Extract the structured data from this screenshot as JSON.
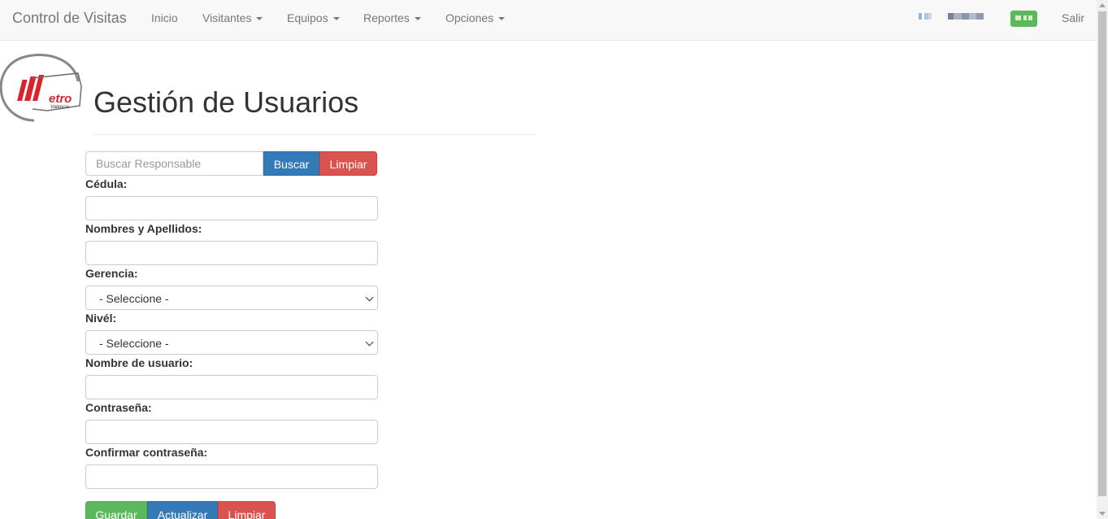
{
  "navbar": {
    "brand": "Control de Visitas",
    "items": [
      {
        "label": "Inicio"
      },
      {
        "label": "Visitantes"
      },
      {
        "label": "Equipos"
      },
      {
        "label": "Reportes"
      },
      {
        "label": "Opciones"
      }
    ],
    "logout_label": "Salir"
  },
  "logo": {
    "text_main": "etro",
    "text_sub": "Valencia"
  },
  "page": {
    "title": "Gestión de Usuarios"
  },
  "search": {
    "placeholder": "Buscar Responsable",
    "search_label": "Buscar",
    "clear_label": "Limpiar"
  },
  "form": {
    "cedula_label": "Cédula:",
    "nombres_label": "Nombres y Apellidos:",
    "gerencia_label": "Gerencia:",
    "gerencia_value": "- Seleccione -",
    "nivel_label": "Nivél:",
    "nivel_value": "- Seleccione -",
    "usuario_label": "Nombre de usuario:",
    "contrasena_label": "Contraseña:",
    "confirmar_label": "Confirmar contraseña:"
  },
  "actions": {
    "save_label": "Guardar",
    "update_label": "Actualizar",
    "clear_label": "Limpiar"
  },
  "colors": {
    "primary": "#337ab7",
    "danger": "#d9534f",
    "success": "#5cb85c",
    "logo_red": "#d7252b"
  }
}
